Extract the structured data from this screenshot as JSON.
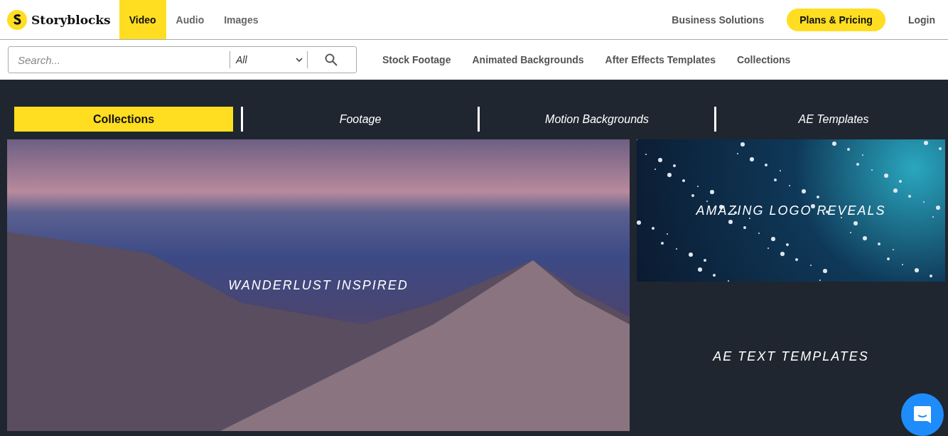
{
  "logo": {
    "text": "Storyblocks"
  },
  "main_nav": [
    {
      "label": "Video",
      "selected": true
    },
    {
      "label": "Audio",
      "selected": false
    },
    {
      "label": "Images",
      "selected": false
    }
  ],
  "account_nav": {
    "business": "Business Solutions",
    "plans": "Plans & Pricing",
    "login": "Login"
  },
  "search": {
    "placeholder": "Search...",
    "category": "All"
  },
  "sub_nav": [
    "Stock Footage",
    "Animated Backgrounds",
    "After Effects Templates",
    "Collections"
  ],
  "tabs": [
    {
      "label": "Collections",
      "selected": true
    },
    {
      "label": "Footage",
      "selected": false
    },
    {
      "label": "Motion Backgrounds",
      "selected": false
    },
    {
      "label": "AE Templates",
      "selected": false
    }
  ],
  "tiles": [
    {
      "title": "WANDERLUST INSPIRED",
      "kind": "mountain"
    },
    {
      "title": "AMAZING LOGO REVEALS",
      "kind": "particles"
    },
    {
      "title": "AE TEXT TEMPLATES",
      "kind": "plain"
    }
  ]
}
